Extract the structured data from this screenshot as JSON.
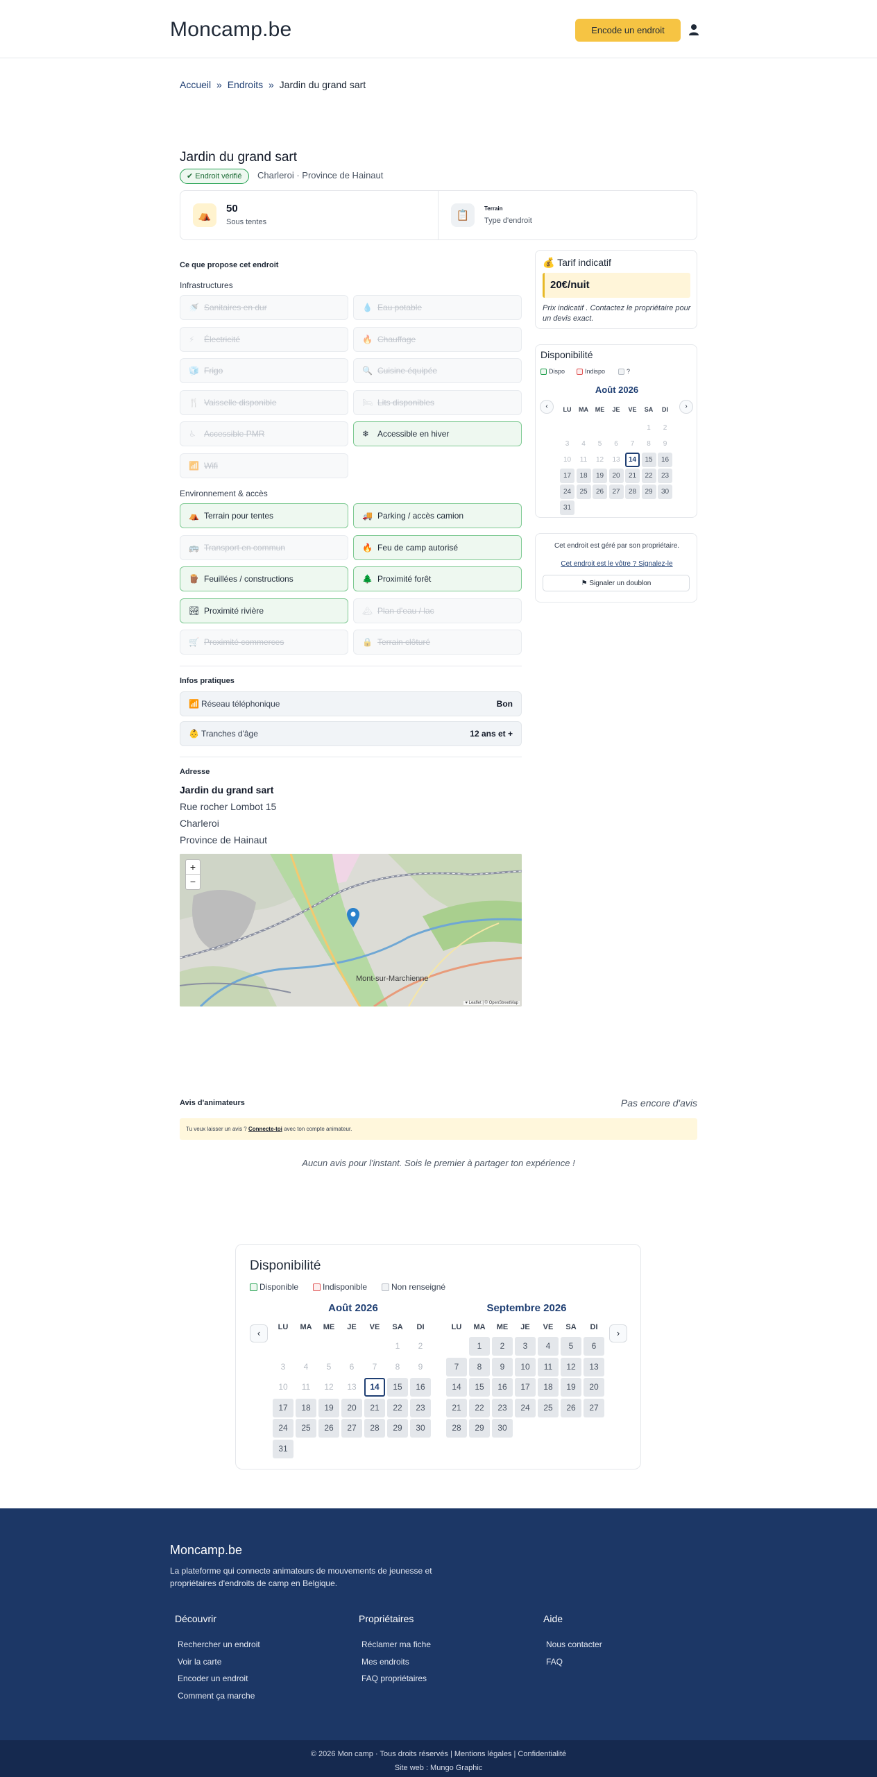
{
  "header": {
    "logo": "Moncamp.be",
    "encode_label": "Encode un endroit",
    "user_icon": "user-icon"
  },
  "breadcrumb": {
    "items": [
      "Accueil",
      "Endroits"
    ],
    "separator": "»",
    "current": "Jardin du grand sart"
  },
  "place": {
    "title": "Jardin du grand sart",
    "verified": "✔ Endroit vérifié",
    "location": "Charleroi · Province de Hainaut",
    "stats": [
      {
        "icon": "tent-icon",
        "value": "50",
        "label": "Sous tentes"
      },
      {
        "icon": "clipboard-icon",
        "value": "Terrain",
        "label": "Type d'endroit"
      }
    ]
  },
  "offers": {
    "heading": "Ce que propose cet endroit",
    "infra_heading": "Infrastructures",
    "infra": [
      {
        "icon": "shower-icon",
        "label": "Sanitaires en dur",
        "on": false
      },
      {
        "icon": "water-drop-icon",
        "label": "Eau potable",
        "on": false
      },
      {
        "icon": "lightning-icon",
        "label": "Électricité",
        "on": false
      },
      {
        "icon": "fire-icon",
        "label": "Chauffage",
        "on": false
      },
      {
        "icon": "fridge-icon",
        "label": "Frigo",
        "on": false
      },
      {
        "icon": "magnifier-icon",
        "label": "Cuisine équipée",
        "on": false
      },
      {
        "icon": "cutlery-icon",
        "label": "Vaisselle disponible",
        "on": false
      },
      {
        "icon": "bed-icon",
        "label": "Lits disponibles",
        "on": false
      },
      {
        "icon": "wheelchair-icon",
        "label": "Accessible PMR",
        "on": false
      },
      {
        "icon": "snowflake-icon",
        "label": "Accessible en hiver",
        "on": true
      },
      {
        "icon": "wifi-icon",
        "label": "Wifi",
        "on": false
      }
    ],
    "env_heading": "Environnement & accès",
    "env": [
      {
        "icon": "tent-icon",
        "label": "Terrain pour tentes",
        "on": true
      },
      {
        "icon": "truck-icon",
        "label": "Parking / accès camion",
        "on": true
      },
      {
        "icon": "bus-icon",
        "label": "Transport en commun",
        "on": false
      },
      {
        "icon": "campfire-icon",
        "label": "Feu de camp autorisé",
        "on": true
      },
      {
        "icon": "wood-icon",
        "label": "Feuillées / constructions",
        "on": true
      },
      {
        "icon": "tree-icon",
        "label": "Proximité forêt",
        "on": true
      },
      {
        "icon": "river-icon",
        "label": "Proximité rivière",
        "on": true
      },
      {
        "icon": "lake-icon",
        "label": "Plan d'eau / lac",
        "on": false
      },
      {
        "icon": "cart-icon",
        "label": "Proximité commerces",
        "on": false
      },
      {
        "icon": "lock-icon",
        "label": "Terrain clôturé",
        "on": false
      }
    ]
  },
  "practical": {
    "heading": "Infos pratiques",
    "rows": [
      {
        "icon": "signal-icon",
        "label": "Réseau téléphonique",
        "value": "Bon"
      },
      {
        "icon": "age-icon",
        "label": "Tranches d'âge",
        "value": "12 ans et +"
      }
    ]
  },
  "address": {
    "heading": "Adresse",
    "name": "Jardin du grand sart",
    "lines": [
      "Rue rocher Lombot 15",
      "Charleroi",
      "Province de Hainaut"
    ],
    "map_zoom_in": "+",
    "map_zoom_out": "−",
    "map_label": "Mont-sur-Marchienne",
    "map_attribution": "♥ Leaflet | © OpenStreetMap"
  },
  "tarif": {
    "title": "💰 Tarif indicatif",
    "price": "20€/nuit",
    "note": "Prix indicatif . Contactez le propriétaire pour un devis exact."
  },
  "availability_small": {
    "title": "Disponibilité",
    "legend": [
      "Dispo",
      "Indispo",
      "?"
    ],
    "month": "Août 2026",
    "prev": "‹",
    "next": "›"
  },
  "owner": {
    "text": "Cet endroit est géré par son propriétaire.",
    "claim_link": "Cet endroit est le vôtre ? Signalez-le",
    "report_label": "⚑ Signaler un doublon"
  },
  "reviews": {
    "heading": "Avis d'animateurs",
    "status": "Pas encore d'avis",
    "login_prefix": "Tu veux laisser un avis ? ",
    "login_link": "Connecte-toi",
    "login_suffix": " avec ton compte animateur.",
    "empty": "Aucun avis pour l'instant. Sois le premier à partager ton expérience !"
  },
  "availability_big": {
    "title": "Disponibilité",
    "legend": [
      "Disponible",
      "Indisponible",
      "Non renseigné"
    ],
    "months": [
      "Août 2026",
      "Septembre 2026"
    ],
    "prev": "‹",
    "next": "›"
  },
  "calendar": {
    "weekdays": [
      "LU",
      "MA",
      "ME",
      "JE",
      "VE",
      "SA",
      "DI"
    ],
    "aug": {
      "offset": 5,
      "days": 31,
      "today": 14
    },
    "sep": {
      "offset": 1,
      "days": 30
    }
  },
  "colors": {
    "accent": "#f6c443",
    "navy": "#1c3766",
    "available_border": "#22a04f",
    "unavailable_border": "#e05656"
  },
  "footer": {
    "logo": "Moncamp.be",
    "tagline": "La plateforme qui connecte animateurs de mouvements de jeunesse et propriétaires d'endroits de camp en Belgique.",
    "columns": [
      {
        "heading": "Découvrir",
        "links": [
          "Rechercher un endroit",
          "Voir la carte",
          "Encoder un endroit",
          "Comment ça marche"
        ]
      },
      {
        "heading": "Propriétaires",
        "links": [
          "Réclamer ma fiche",
          "Mes endroits",
          "FAQ propriétaires"
        ]
      },
      {
        "heading": "Aide",
        "links": [
          "Nous contacter",
          "FAQ"
        ]
      }
    ],
    "copyright": "© 2026 Mon camp · Tous droits réservés | Mentions légales | Confidentialité",
    "site": "Site web : Mungo Graphic"
  }
}
